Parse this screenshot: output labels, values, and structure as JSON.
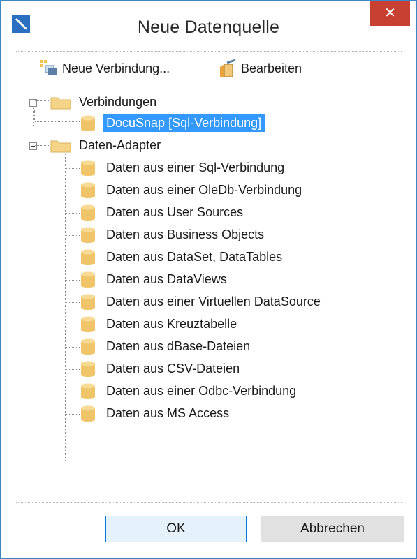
{
  "window": {
    "title": "Neue Datenquelle",
    "close_glyph": "✕"
  },
  "toolbar": {
    "new_connection_label": "Neue Verbindung...",
    "edit_label": "Bearbeiten"
  },
  "tree": {
    "group_connections": {
      "label": "Verbindungen",
      "items": [
        "DocuSnap [Sql-Verbindung]"
      ],
      "selected_index": 0
    },
    "group_adapters": {
      "label": "Daten-Adapter",
      "items": [
        "Daten aus einer Sql-Verbindung",
        "Daten aus einer OleDb-Verbindung",
        "Daten aus User Sources",
        "Daten aus Business Objects",
        "Daten aus DataSet, DataTables",
        "Daten aus DataViews",
        "Daten aus einer Virtuellen DataSource",
        "Daten aus Kreuztabelle",
        "Daten aus dBase-Dateien",
        "Daten aus CSV-Dateien",
        "Daten aus einer Odbc-Verbindung",
        "Daten aus MS Access"
      ]
    }
  },
  "buttons": {
    "ok_label": "OK",
    "cancel_label": "Abbrechen"
  },
  "colors": {
    "selection": "#3399ff",
    "close_button": "#c84031",
    "folder": "#f5d488",
    "database": "#f0c468"
  },
  "icons": {
    "app": "pen-icon",
    "new_connection": "new-connection-icon",
    "edit": "edit-icon",
    "folder": "folder-icon",
    "database": "database-icon",
    "expander": "collapse-icon"
  }
}
